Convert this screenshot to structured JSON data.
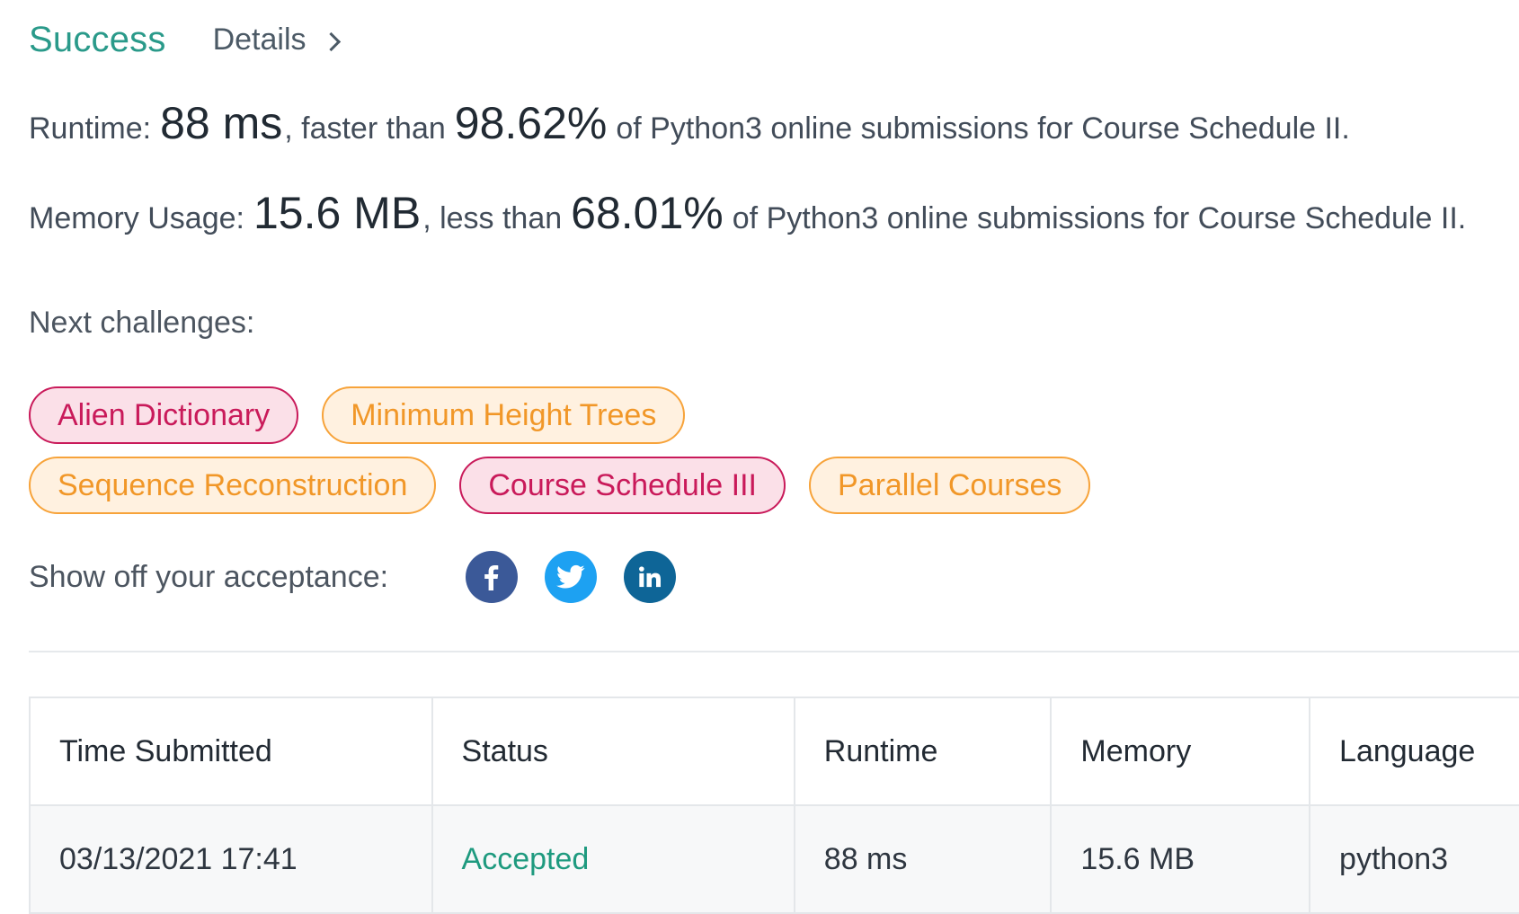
{
  "header": {
    "status": "Success",
    "details_label": "Details"
  },
  "runtime": {
    "label": "Runtime:",
    "value": "88 ms",
    "comparison": ", faster than",
    "percent": "98.62%",
    "suffix": "of Python3 online submissions for Course Schedule II."
  },
  "memory": {
    "label": "Memory Usage:",
    "value": "15.6 MB",
    "comparison": ", less than",
    "percent": "68.01%",
    "suffix": "of Python3 online submissions for Course Schedule II."
  },
  "next_challenges": {
    "label": "Next challenges:",
    "items": [
      {
        "label": "Alien Dictionary",
        "difficulty": "hard"
      },
      {
        "label": "Minimum Height Trees",
        "difficulty": "medium"
      },
      {
        "label": "Sequence Reconstruction",
        "difficulty": "medium"
      },
      {
        "label": "Course Schedule III",
        "difficulty": "hard"
      },
      {
        "label": "Parallel Courses",
        "difficulty": "medium"
      }
    ]
  },
  "share": {
    "label": "Show off your acceptance:",
    "icons": [
      "facebook-icon",
      "twitter-icon",
      "linkedin-icon"
    ]
  },
  "submissions": {
    "headers": [
      "Time Submitted",
      "Status",
      "Runtime",
      "Memory",
      "Language"
    ],
    "rows": [
      {
        "time": "03/13/2021 17:41",
        "status": "Accepted",
        "runtime": "88 ms",
        "memory": "15.6 MB",
        "language": "python3"
      }
    ]
  },
  "colors": {
    "success": "#2a9a8a",
    "hard": "#c91a5a",
    "medium": "#f19728",
    "accepted": "#1e9a7f",
    "facebook": "#3b5998",
    "twitter": "#1da1f2",
    "linkedin": "#0e6597"
  }
}
